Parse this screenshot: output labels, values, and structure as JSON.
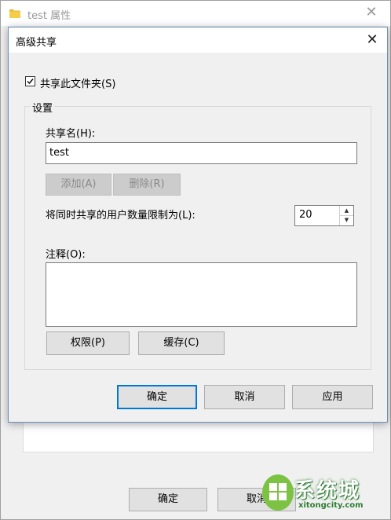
{
  "back_window": {
    "title": "test 属性",
    "close_glyph": "✕",
    "ok_label": "确定",
    "cancel_label": "取消"
  },
  "dialog": {
    "title": "高级共享",
    "close_glyph": "✕",
    "share_checkbox": {
      "label": "共享此文件夹(S)",
      "checked": true
    },
    "settings_group_label": "设置",
    "share_name_label": "共享名(H):",
    "share_name_value": "test",
    "add_button": "添加(A)",
    "remove_button": "删除(R)",
    "user_limit_label": "将同时共享的用户数量限制为(L):",
    "user_limit_value": "20",
    "comment_label": "注释(O):",
    "comment_value": "",
    "permissions_button": "权限(P)",
    "caching_button": "缓存(C)",
    "ok_button": "确定",
    "cancel_button": "取消",
    "apply_button": "应用"
  },
  "watermark": {
    "text": "系统城",
    "sub": "xitongcity.com"
  },
  "colors": {
    "accent": "#0078d7",
    "dialog_border": "#6b8fbf",
    "watermark_green": "#2e7d32"
  }
}
